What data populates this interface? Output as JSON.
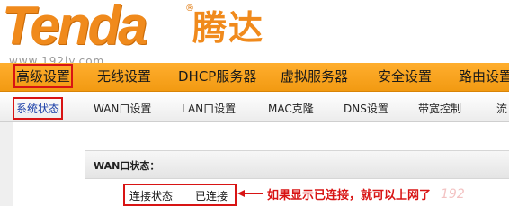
{
  "brand": {
    "logo_text": "Tenda",
    "logo_reg": "®",
    "logo_cn": "腾达",
    "color": "#f08a1c"
  },
  "watermark": "www.192ly.com",
  "main_nav": {
    "items": [
      "高级设置",
      "无线设置",
      "DHCP服务器",
      "虚拟服务器",
      "安全设置",
      "路由设置"
    ],
    "active_index": 0
  },
  "sub_nav": {
    "items": [
      "系统状态",
      "WAN口设置",
      "LAN口设置",
      "MAC克隆",
      "DNS设置",
      "带宽控制",
      "流"
    ],
    "active_index": 0
  },
  "wan_section": {
    "title": "WAN口状态：",
    "connection_label": "连接状态",
    "connection_value": "已连接"
  },
  "annotation": {
    "note": "如果显示已连接，就可以上网了",
    "highlight_color": "#d81414"
  },
  "corner_watermark": "192"
}
